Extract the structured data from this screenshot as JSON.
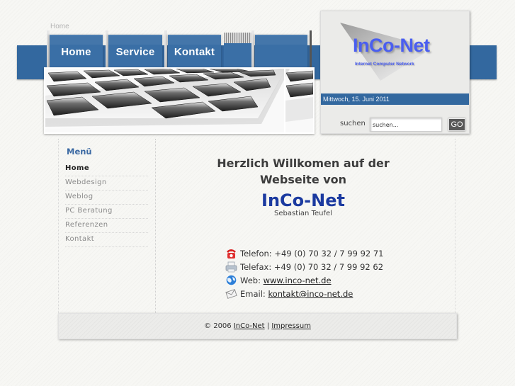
{
  "breadcrumb": "Home",
  "colors": {
    "brand_blue": "#33689f",
    "nav_tab": "#3a6fa6",
    "logo_blue": "#4a5ef0",
    "brand_name": "#1b3aa0",
    "menu_title": "#3b69a3"
  },
  "nav": {
    "tabs": [
      {
        "label": "Home"
      },
      {
        "label": "Service"
      },
      {
        "label": "Kontakt"
      },
      {
        "label": ""
      }
    ]
  },
  "header": {
    "image_alt": "keyboard-photo",
    "logo": {
      "title": "InCo-Net",
      "subtitle": "Internet Computer Network"
    },
    "date": "Mittwoch, 15. Juni 2011",
    "search": {
      "label": "suchen",
      "placeholder": "suchen...",
      "value": "suchen...",
      "button": "GO"
    }
  },
  "sidebar": {
    "title": "Menü",
    "items": [
      {
        "label": "Home",
        "active": true
      },
      {
        "label": "Webdesign"
      },
      {
        "label": "Weblog"
      },
      {
        "label": "PC Beratung"
      },
      {
        "label": "Referenzen"
      },
      {
        "label": "Kontakt"
      }
    ]
  },
  "main": {
    "welcome_line1": "Herzlich Willkomen auf der",
    "welcome_line2": "Webseite von",
    "brand_name": "InCo-Net",
    "owner": "Sebastian Teufel",
    "contacts": [
      {
        "icon": "phone-icon",
        "label": "Telefon:",
        "value": "+49 (0) 70 32 / 7 99 92 71",
        "link": false
      },
      {
        "icon": "fax-icon",
        "label": "Telefax:",
        "value": "+49 (0) 70 32 / 7 99 92 62",
        "link": false
      },
      {
        "icon": "globe-icon",
        "label": "Web:",
        "value": "www.inco-net.de",
        "link": true
      },
      {
        "icon": "mail-icon",
        "label": "Email:",
        "value": "kontakt@inco-net.de",
        "link": true
      }
    ]
  },
  "footer": {
    "copyright": "© 2006",
    "brand_link": "InCo-Net",
    "separator": "|",
    "imprint_link": "Impressum"
  }
}
